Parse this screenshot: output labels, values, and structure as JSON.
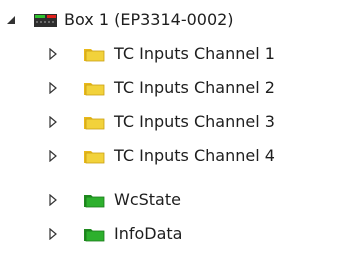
{
  "tree": {
    "root": {
      "label": "Box 1 (EP3314-0002)",
      "icon": "ethercat-box-icon",
      "expanded": true,
      "colors": {
        "body": "#2d2d2d",
        "top_left": "#2fc22f",
        "top_right": "#e0201c"
      }
    },
    "children": [
      {
        "label": "TC Inputs Channel 1",
        "icon": "folder-yellow-icon",
        "expanded": false,
        "color": "#f2d23b"
      },
      {
        "label": "TC Inputs Channel 2",
        "icon": "folder-yellow-icon",
        "expanded": false,
        "color": "#f2d23b"
      },
      {
        "label": "TC Inputs Channel 3",
        "icon": "folder-yellow-icon",
        "expanded": false,
        "color": "#f2d23b"
      },
      {
        "label": "TC Inputs Channel 4",
        "icon": "folder-yellow-icon",
        "expanded": false,
        "color": "#f2d23b"
      },
      {
        "label": "WcState",
        "icon": "folder-green-icon",
        "expanded": false,
        "color": "#2db02d"
      },
      {
        "label": "InfoData",
        "icon": "folder-green-icon",
        "expanded": false,
        "color": "#2db02d"
      }
    ]
  }
}
